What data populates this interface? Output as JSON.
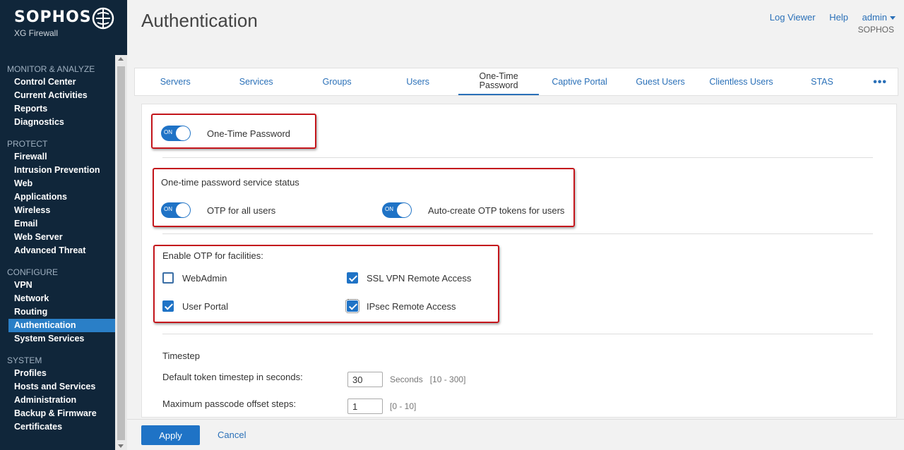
{
  "brand": {
    "name": "SOPHOS",
    "product": "XG Firewall"
  },
  "nav": {
    "sections": [
      {
        "title": "MONITOR & ANALYZE",
        "items": [
          "Control Center",
          "Current Activities",
          "Reports",
          "Diagnostics"
        ]
      },
      {
        "title": "PROTECT",
        "items": [
          "Firewall",
          "Intrusion Prevention",
          "Web",
          "Applications",
          "Wireless",
          "Email",
          "Web Server",
          "Advanced Threat"
        ]
      },
      {
        "title": "CONFIGURE",
        "items": [
          "VPN",
          "Network",
          "Routing",
          "Authentication",
          "System Services"
        ]
      },
      {
        "title": "SYSTEM",
        "items": [
          "Profiles",
          "Hosts and Services",
          "Administration",
          "Backup & Firmware",
          "Certificates"
        ]
      }
    ],
    "active": "Authentication"
  },
  "header": {
    "title": "Authentication",
    "log_viewer": "Log Viewer",
    "help": "Help",
    "user": "admin",
    "org": "SOPHOS"
  },
  "tabs": {
    "servers": "Servers",
    "services": "Services",
    "groups": "Groups",
    "users": "Users",
    "otp_line1": "One-Time",
    "otp_line2": "Password",
    "captive": "Captive Portal",
    "guest": "Guest Users",
    "clientless": "Clientless Users",
    "stas": "STAS",
    "more": "•••"
  },
  "otp": {
    "toggle_state": "ON",
    "main_label": "One-Time Password",
    "service_status_label": "One-time password service status",
    "all_users_label": "OTP for all users",
    "auto_create_label": "Auto-create OTP tokens for users",
    "facilities_label": "Enable OTP for facilities:",
    "facilities": {
      "webadmin": "WebAdmin",
      "ssl_vpn": "SSL VPN Remote Access",
      "user_portal": "User Portal",
      "ipsec": "IPsec Remote Access"
    },
    "timestep_heading": "Timestep",
    "timestep_label": "Default token timestep in seconds:",
    "timestep_value": "30",
    "timestep_unit": "Seconds",
    "timestep_range": "[10 - 300]",
    "offset_label": "Maximum passcode offset steps:",
    "offset_value": "1",
    "offset_range": "[0 - 10]"
  },
  "footer": {
    "apply": "Apply",
    "cancel": "Cancel"
  },
  "colors": {
    "sidebar": "#10263a",
    "accent": "#1f73c6",
    "highlight": "#c4161c"
  }
}
